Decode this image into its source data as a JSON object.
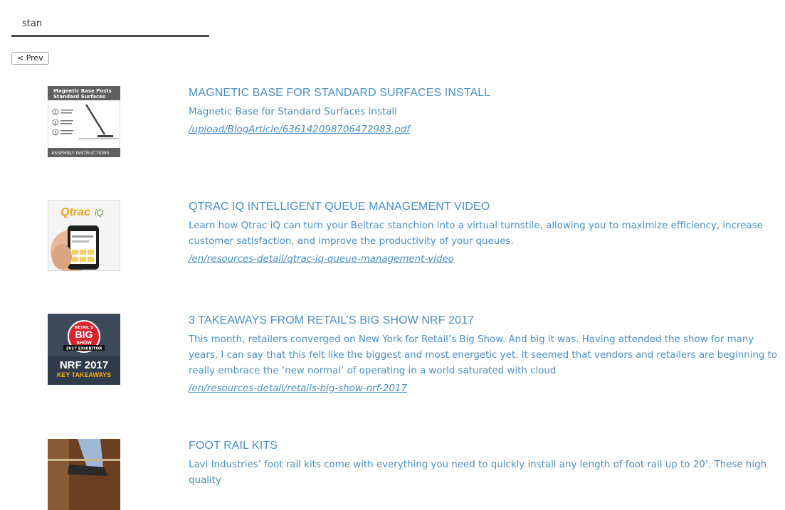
{
  "search": {
    "value": "stan"
  },
  "pagination": {
    "prev_label": "< Prev"
  },
  "results": [
    {
      "title": "MAGNETIC BASE FOR STANDARD SURFACES INSTALL",
      "description": "Magnetic Base for Standard Surfaces Install",
      "link": "/upload/BlogArticle/636142098706472983.pdf",
      "thumb": {
        "line1": "Magnetic Base Posts",
        "line2": "Standard Surfaces",
        "footer": "ASSEMBLY INSTRUCTIONS",
        "steps": [
          "1",
          "2",
          "3"
        ]
      }
    },
    {
      "title": "QTRAC IQ INTELLIGENT QUEUE MANAGEMENT VIDEO",
      "description": "Learn how Qtrac iQ can turn your Beltrac stanchion into a virtual turnstile, allowing you to maximize efficiency, increase customer satisfaction, and improve the productivity of your queues.",
      "link": "/en/resources-detail/qtrac-iq-queue-management-video",
      "thumb": {
        "logo": "Qtrac",
        "logo_suffix": "iQ"
      }
    },
    {
      "title": "3 TAKEAWAYS FROM RETAIL’S BIG SHOW NRF 2017",
      "description": "This month, retailers converged on New York for Retail’s Big Show. And big it was. Having attended the show for many years, I can say that this felt like the biggest and most energetic yet. It seemed that vendors and retailers are beginning to really embrace the ‘new normal’ of operating in a world saturated with cloud",
      "link": "/en/resources-detail/retails-big-show-nrf-2017",
      "thumb": {
        "badge_top": "RETAIL'S",
        "badge_big": "BIG",
        "badge_show": "SHOW",
        "exhibitor": "2017 EXHIBITOR",
        "headline": "NRF 2017",
        "subline": "KEY TAKEAWAYS"
      }
    },
    {
      "title": "FOOT RAIL KITS",
      "description": "Lavi Industries’ foot rail kits come with everything you need to quickly install any length of foot rail up to 20’. These high quality",
      "link": "",
      "thumb": {}
    }
  ]
}
